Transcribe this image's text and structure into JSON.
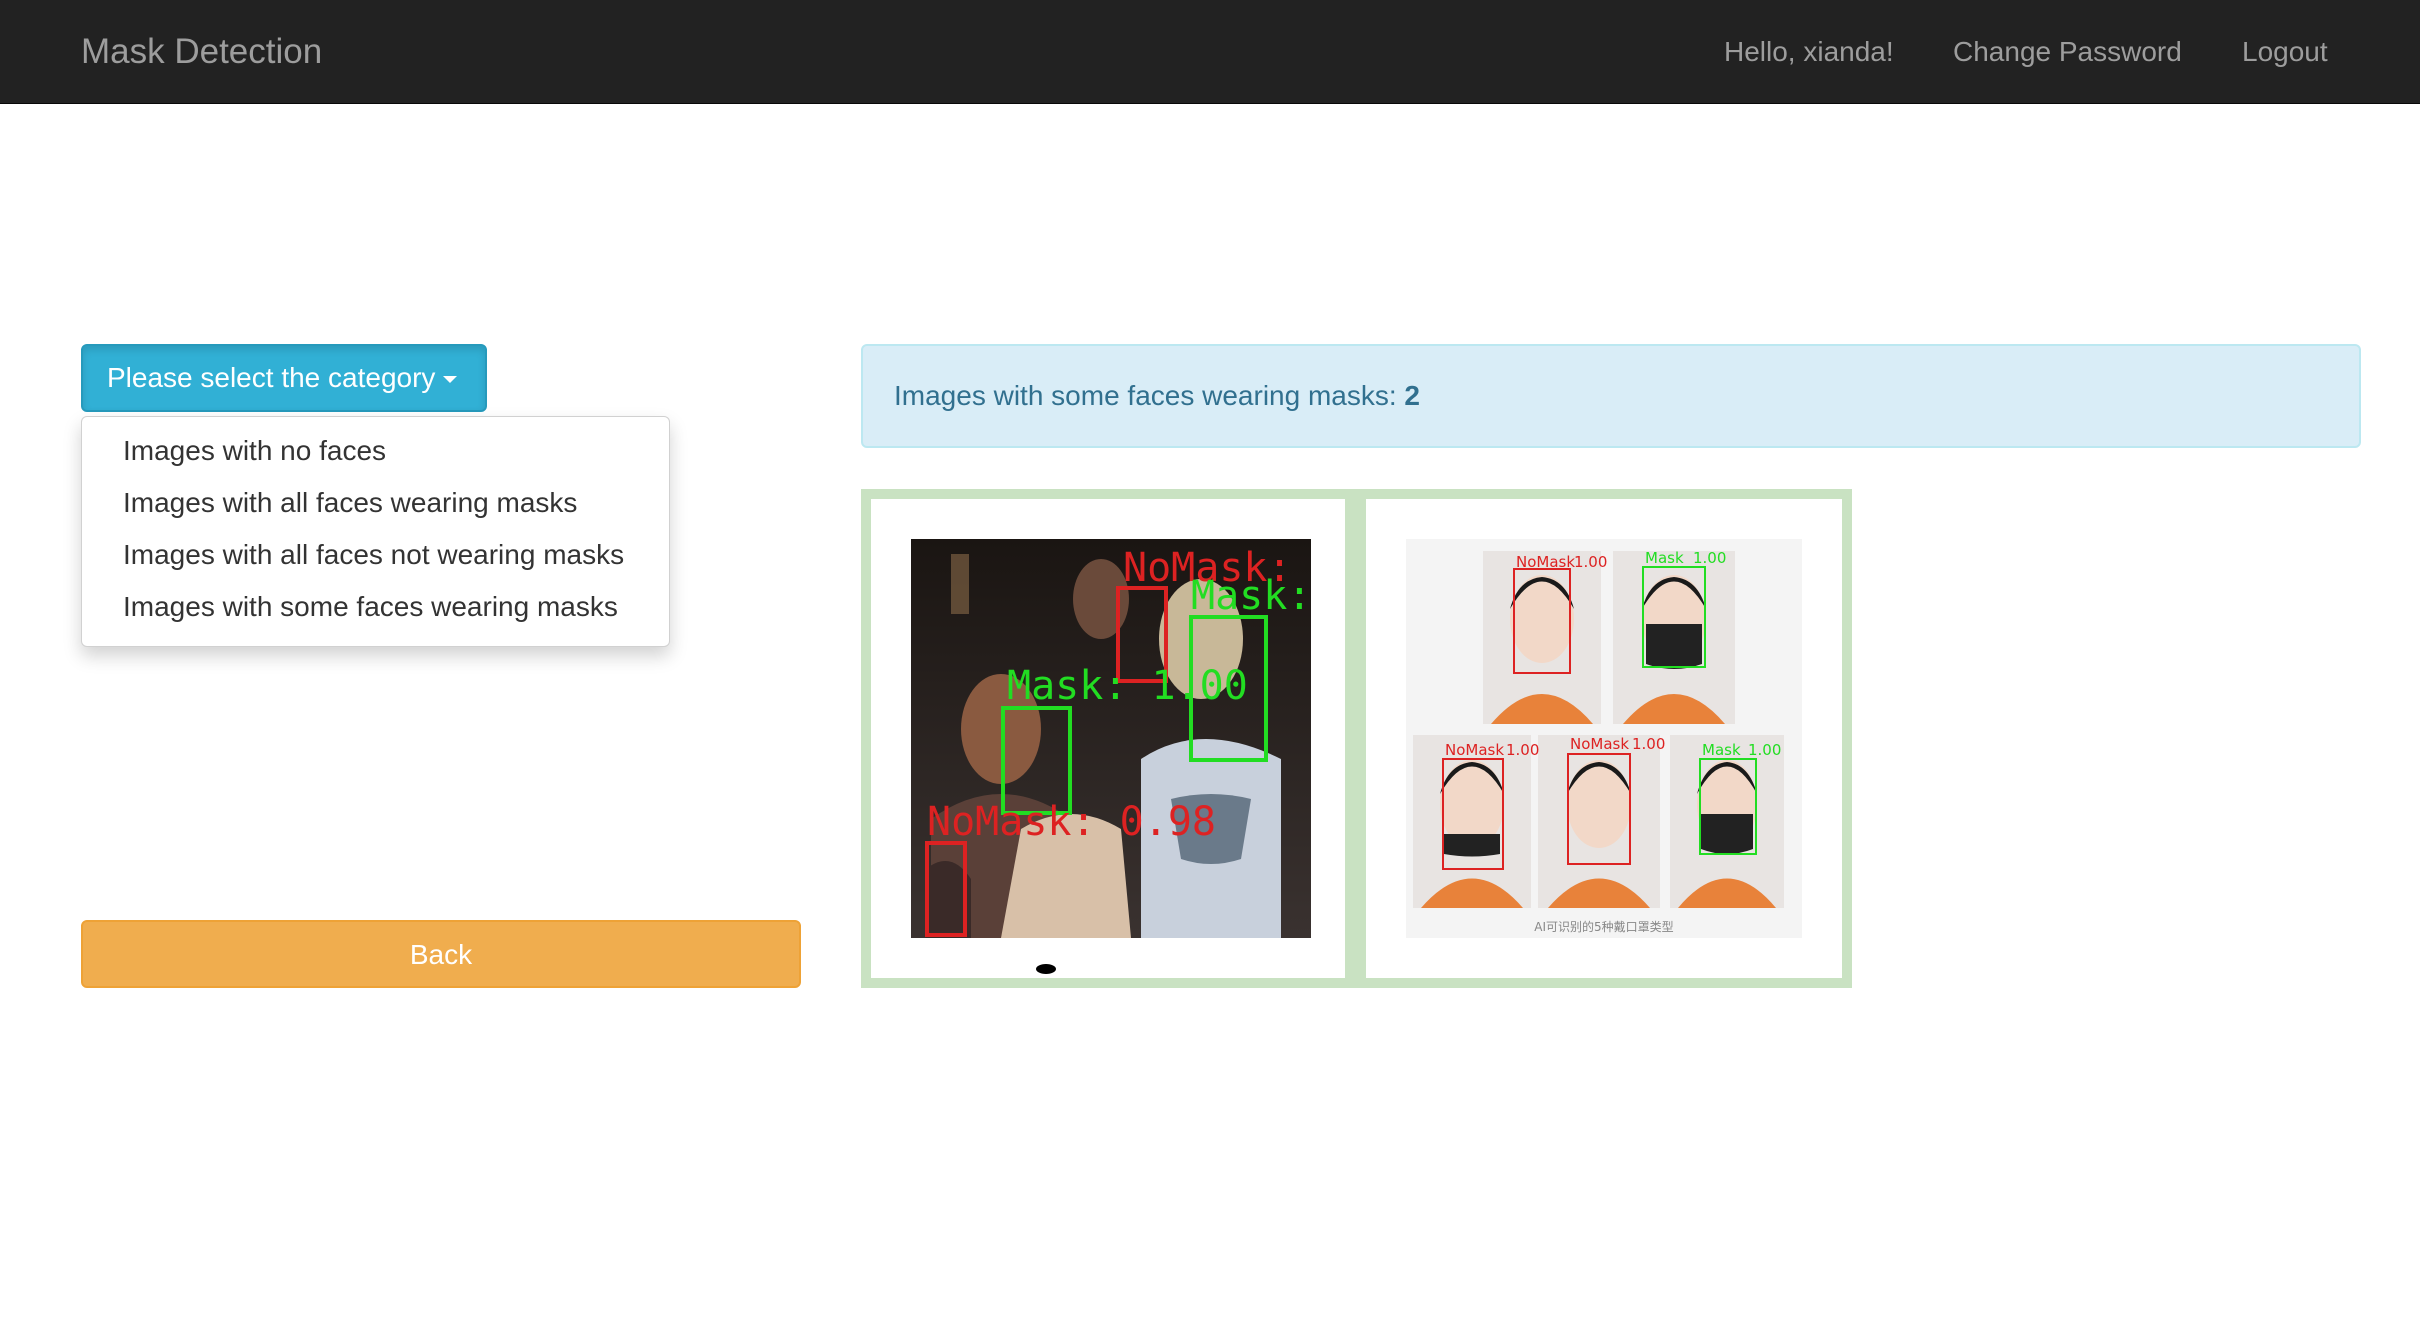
{
  "navbar": {
    "brand": "Mask Detection",
    "greeting": "Hello, xianda!",
    "change_password": "Change Password",
    "logout": "Logout"
  },
  "category_dropdown": {
    "button_label": "Please select the category",
    "options": [
      "Images with no faces",
      "Images with all faces wearing masks",
      "Images with all faces not wearing masks",
      "Images with some faces wearing masks"
    ]
  },
  "back_button": "Back",
  "result": {
    "label": "Images with some faces wearing masks:",
    "count": "2"
  },
  "images": {
    "image1": {
      "labels": {
        "nomask_top": "NoMask:",
        "mask_right": "Mask:",
        "mask_center": "Mask: 1.00",
        "nomask_bottom": "NoMask: 0.98"
      }
    },
    "image2": {
      "labels": {
        "nomask": "NoMask",
        "mask": "Mask",
        "score": "1.00"
      },
      "caption": "AI可识别的5种戴口罩类型"
    }
  },
  "colors": {
    "navbar_bg": "#222222",
    "info_button": "#31b0d5",
    "warning_button": "#f0ad4e",
    "alert_bg": "#d9edf7",
    "alert_text": "#31708f",
    "gallery_border": "#c9e2c2",
    "mask_box": "#22dd22",
    "nomask_box": "#dd2222"
  }
}
